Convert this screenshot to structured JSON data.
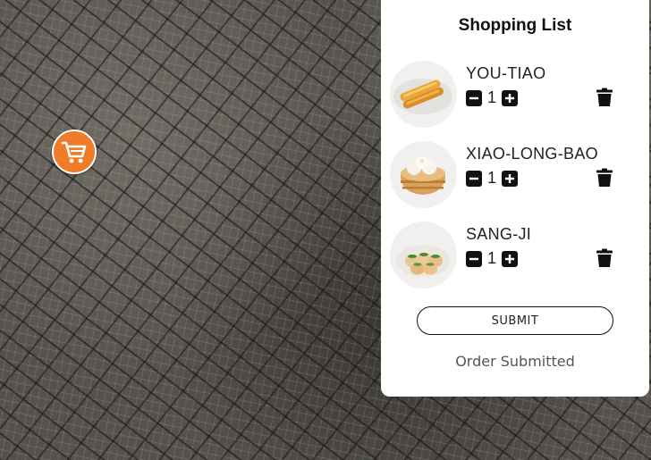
{
  "panel": {
    "title": "Shopping List",
    "items": [
      {
        "name": "YOU-TIAO",
        "quantity": "1"
      },
      {
        "name": "XIAO-LONG-BAO",
        "quantity": "1"
      },
      {
        "name": "SANG-JI",
        "quantity": "1"
      }
    ],
    "submit_label": "SUBMIT",
    "status": "Order Submitted"
  },
  "colors": {
    "cart_accent": "#f07c2a",
    "panel_bg": "#ffffff"
  },
  "icons": [
    "shopping-cart-icon",
    "minus-icon",
    "plus-icon",
    "trash-icon"
  ]
}
